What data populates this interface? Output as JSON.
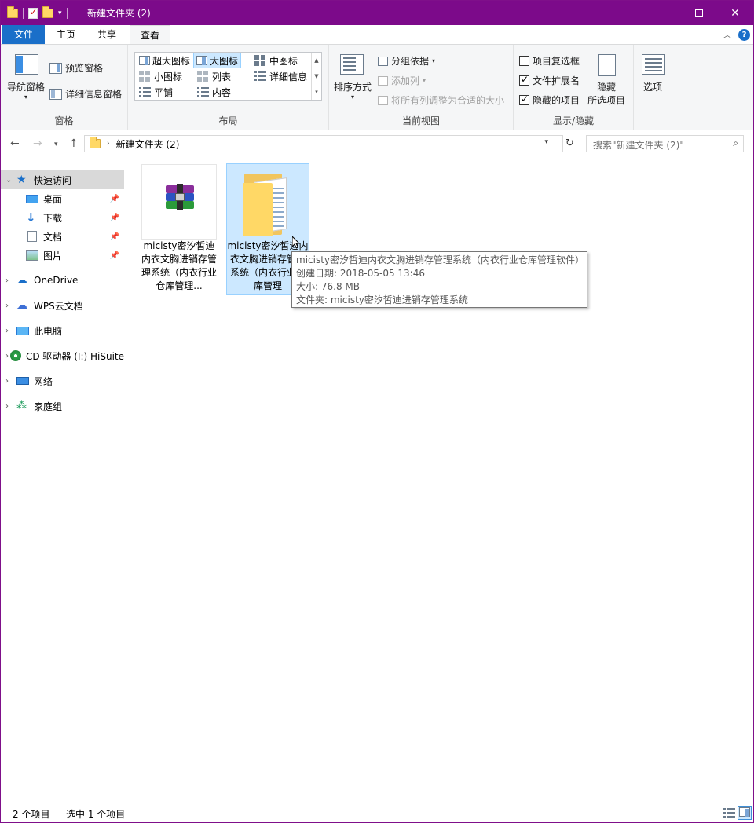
{
  "window": {
    "title": "新建文件夹 (2)",
    "accent": "#7c0a8a"
  },
  "ribbon_tabs": [
    "文件",
    "主页",
    "共享",
    "查看"
  ],
  "active_tab": "查看",
  "ribbon": {
    "panes": {
      "nav_pane": "导航窗格",
      "preview_pane": "预览窗格",
      "details_pane": "详细信息窗格",
      "label": "窗格"
    },
    "layout": {
      "items": [
        "超大图标",
        "大图标",
        "中图标",
        "小图标",
        "列表",
        "详细信息",
        "平铺",
        "内容"
      ],
      "selected": "大图标",
      "label": "布局"
    },
    "current_view": {
      "sort_by": "排序方式",
      "group_by": "分组依据",
      "add_columns": "添加列",
      "size_all_columns": "将所有列调整为合适的大小",
      "label": "当前视图"
    },
    "show_hide": {
      "item_checkboxes": "项目复选框",
      "item_checkboxes_checked": false,
      "file_extensions": "文件扩展名",
      "file_extensions_checked": true,
      "hidden_items": "隐藏的项目",
      "hidden_items_checked": true,
      "hide_selected_line1": "隐藏",
      "hide_selected_line2": "所选项目",
      "label": "显示/隐藏"
    },
    "options": "选项"
  },
  "address": {
    "path": "新建文件夹 (2)",
    "search_placeholder": "搜索\"新建文件夹 (2)\""
  },
  "nav_pane": {
    "quick_access": "快速访问",
    "quick_items": [
      "桌面",
      "下载",
      "文档",
      "图片"
    ],
    "onedrive": "OneDrive",
    "wps": "WPS云文档",
    "this_pc": "此电脑",
    "cd_drive": "CD 驱动器 (I:) HiSuite",
    "network": "网络",
    "homegroup": "家庭组"
  },
  "files": [
    {
      "name": "micisty密汐皙迪内衣文胸进销存管理系统（内衣行业仓库管理...",
      "type": "rar-archive",
      "selected": false
    },
    {
      "name": "micisty密汐皙迪内衣文胸进销存管理系统（内衣行业仓库管理",
      "type": "folder",
      "selected": true
    }
  ],
  "tooltip": {
    "line1": "micisty密汐皙迪内衣文胸进销存管理系统（内衣行业仓库管理软件）",
    "line2": "创建日期: 2018-05-05 13:46",
    "line3": "大小: 76.8 MB",
    "line4": "文件夹: micisty密汐皙迪进销存管理系统"
  },
  "status": {
    "item_count": "2 个项目",
    "selected_count": "选中 1 个项目"
  }
}
